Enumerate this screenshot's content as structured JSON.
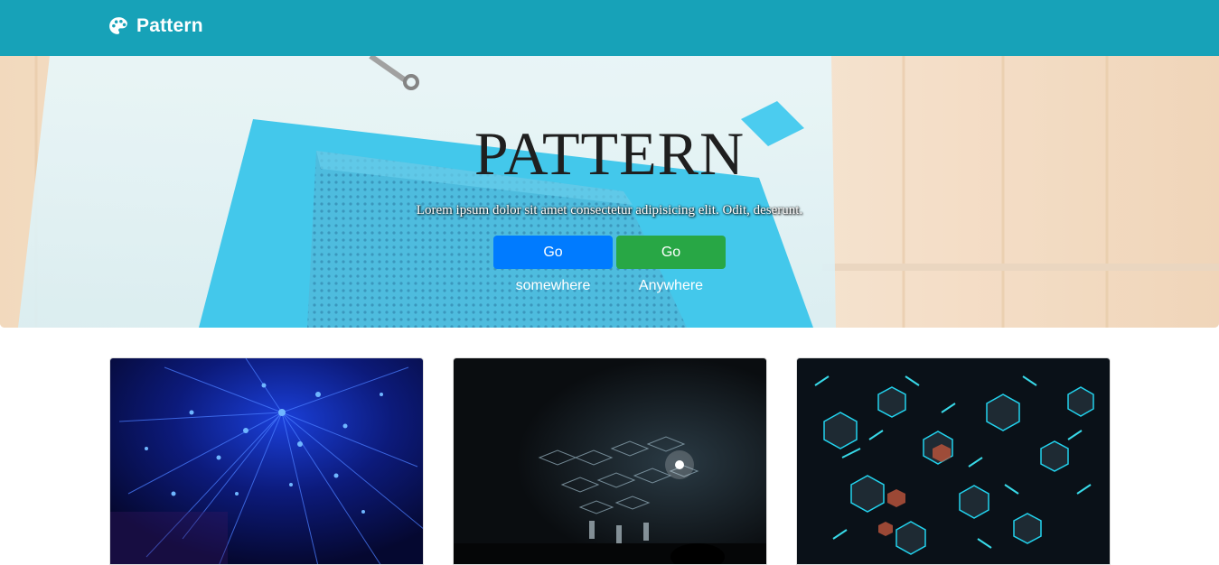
{
  "navbar": {
    "brand_icon": "palette-icon",
    "brand_name": "Pattern",
    "background": "#17a2b8"
  },
  "hero": {
    "title": "PATTERN",
    "lead": "Lorem ipsum dolor sit amet consectetur adipisicing elit. Odit, deserunt.",
    "buttons": {
      "primary_label": "Go somewhere",
      "success_label": "Go Anywhere"
    },
    "colors": {
      "primary": "#007bff",
      "success": "#28a745"
    }
  },
  "cards": [
    {
      "image": "blue-fiber-optic-lights-image"
    },
    {
      "image": "dark-stage-cube-lights-image"
    },
    {
      "image": "neon-cubes-image"
    }
  ]
}
